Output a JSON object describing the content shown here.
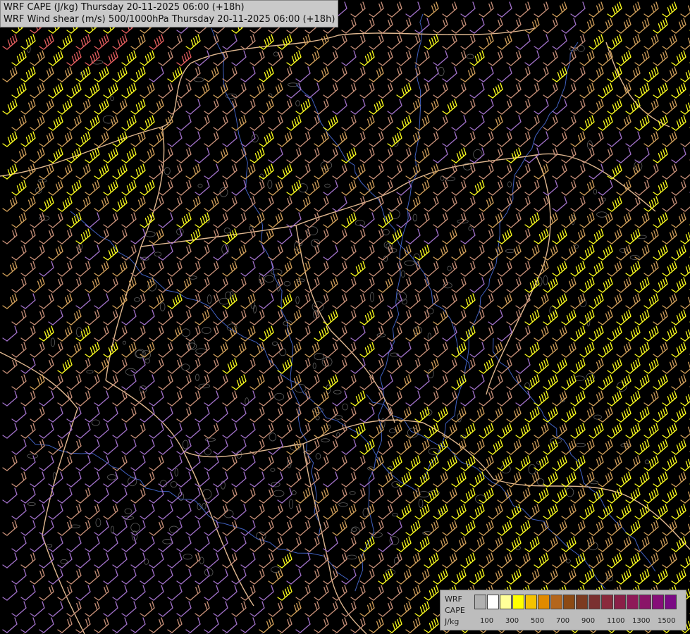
{
  "titles": {
    "line1": "WRF CAPE (J/kg) Thursday 20-11-2025 06:00 (+18h)",
    "line2": "WRF Wind shear (m/s) 500/1000hPa Thursday 20-11-2025 06:00 (+18h)"
  },
  "legend": {
    "model_label": "WRF",
    "field_label": "CAPE",
    "unit_label": "J/kg",
    "tick_labels": [
      "100",
      "300",
      "500",
      "700",
      "900",
      "1100",
      "1300",
      "1500"
    ],
    "colors": [
      "#b0b0b0",
      "#ffffff",
      "#ffff99",
      "#ffff00",
      "#f5c200",
      "#e08a00",
      "#b4661c",
      "#8c4a14",
      "#7c3a20",
      "#7a3030",
      "#8a2a3c",
      "#8a2048",
      "#8e1a58",
      "#8a1468",
      "#860e78",
      "#7a0a84"
    ]
  },
  "barb_palette": {
    "weak": "#a070c8",
    "moderate": "#c89078",
    "strong": "#d2a05a",
    "very_strong": "#ffff1e",
    "extreme": "#e86060"
  },
  "map_colors": {
    "background": "#000000",
    "borders": "#e0b890",
    "rivers": "#4060c0",
    "terrain_contours": "#888888"
  }
}
